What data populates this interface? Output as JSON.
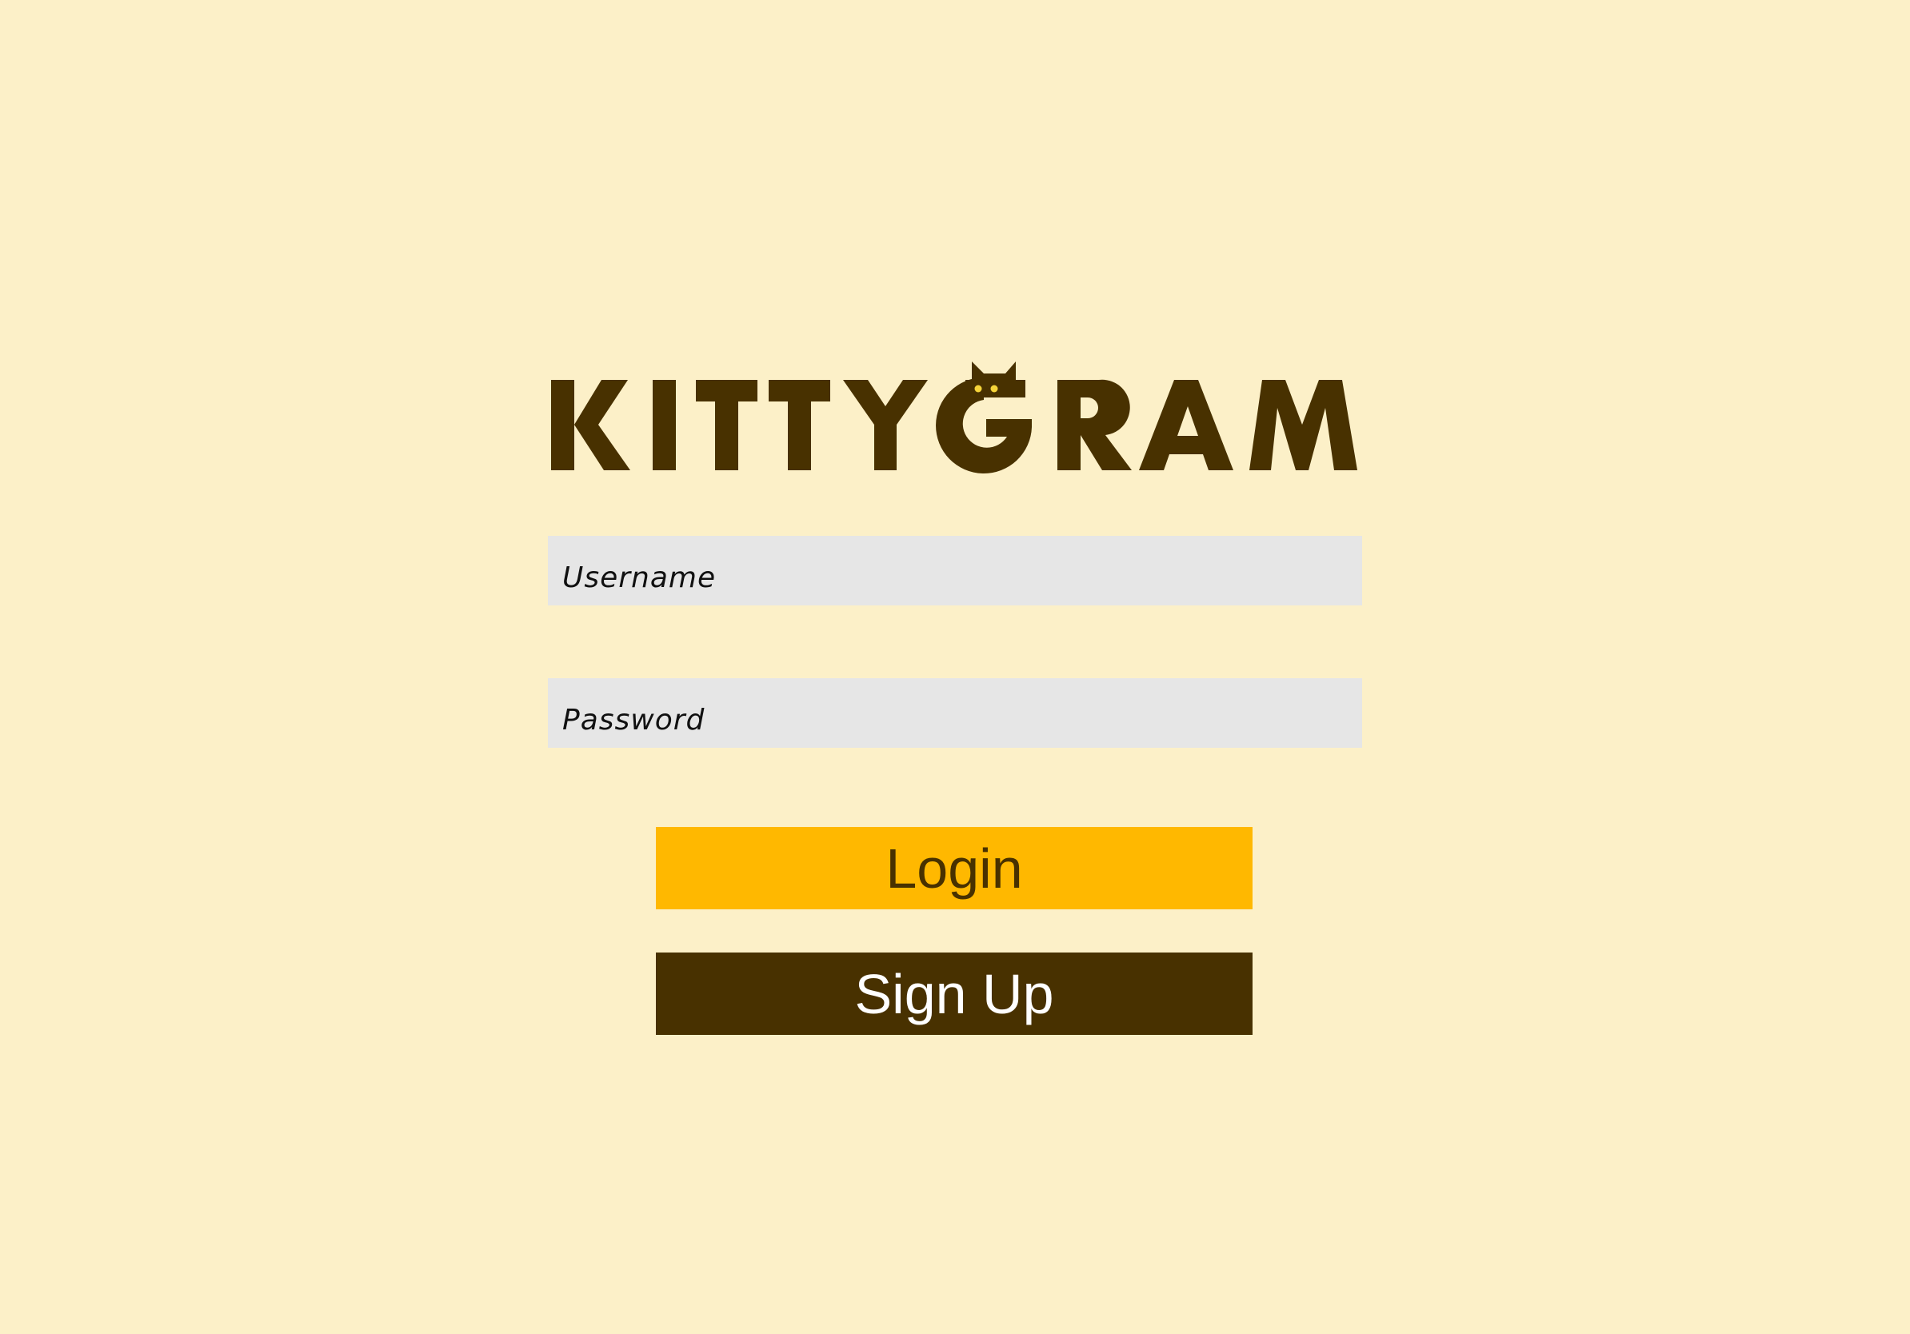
{
  "brand": {
    "name": "KITTYGRAM",
    "color": "#483100",
    "eye_color": "#F5D43A"
  },
  "form": {
    "username": {
      "placeholder": "Username",
      "value": ""
    },
    "password": {
      "placeholder": "Password",
      "value": ""
    }
  },
  "buttons": {
    "login_label": "Login",
    "signup_label": "Sign Up"
  },
  "colors": {
    "background": "#FCF0C8",
    "field_background": "#E6E6E6",
    "login_button": "#FFB800",
    "signup_button": "#483100"
  }
}
